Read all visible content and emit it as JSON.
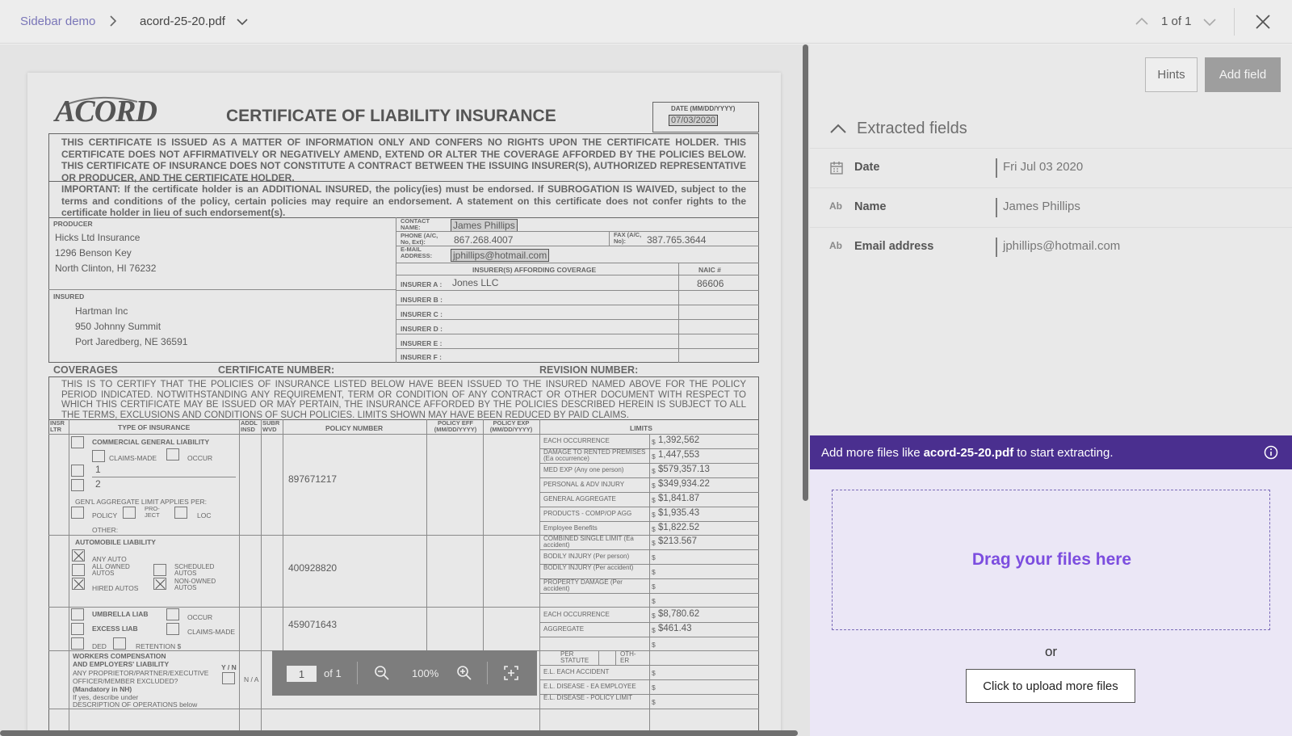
{
  "breadcrumb": {
    "root": "Sidebar demo",
    "file": "acord-25-20.pdf"
  },
  "pager": {
    "text": "1 of 1"
  },
  "document": {
    "title": "CERTIFICATE OF LIABILITY INSURANCE",
    "logo": "ACORD",
    "date_label": "DATE (MM/DD/YYYY)",
    "date_value": "07/03/2020",
    "disclaimer": "THIS CERTIFICATE IS ISSUED AS A MATTER OF INFORMATION ONLY AND CONFERS NO RIGHTS UPON THE CERTIFICATE HOLDER. THIS CERTIFICATE DOES NOT AFFIRMATIVELY OR NEGATIVELY AMEND, EXTEND OR ALTER THE COVERAGE AFFORDED BY THE POLICIES BELOW. THIS CERTIFICATE OF INSURANCE DOES NOT CONSTITUTE A CONTRACT BETWEEN THE ISSUING INSURER(S), AUTHORIZED REPRESENTATIVE OR PRODUCER, AND THE CERTIFICATE HOLDER.",
    "important": "IMPORTANT: If the certificate holder is an ADDITIONAL INSURED, the policy(ies) must be endorsed. If SUBROGATION IS WAIVED, subject to the terms and conditions of the policy, certain policies may require an endorsement. A statement on this certificate does not confer rights to the certificate holder in lieu of such endorsement(s).",
    "producer_label": "PRODUCER",
    "producer_lines": [
      "Hicks Ltd Insurance",
      "1296 Benson Key",
      "North Clinton, HI 76232"
    ],
    "contact_label": "CONTACT NAME:",
    "contact_name": "James Phillips",
    "phone_label": "PHONE (A/C, No, Ext):",
    "phone": "867.268.4007",
    "fax_label": "FAX (A/C, No):",
    "fax": "387.765.3644",
    "email_label": "E-MAIL ADDRESS:",
    "email": "jphillips@hotmail.com",
    "insurers_header": "INSURER(S) AFFORDING COVERAGE",
    "naic_header": "NAIC #",
    "insurer_a_label": "INSURER A :",
    "insurer_a": "Jones LLC",
    "insurer_a_naic": "86606",
    "insurer_labels": [
      "INSURER B :",
      "INSURER C :",
      "INSURER D :",
      "INSURER E :",
      "INSURER F :"
    ],
    "insured_label": "INSURED",
    "insured_lines": [
      "Hartman Inc",
      "950 Johnny Summit",
      "Port Jaredberg, NE 36591"
    ],
    "coverages": "COVERAGES",
    "cert_number": "CERTIFICATE NUMBER:",
    "revision_number": "REVISION NUMBER:",
    "coverage_text": "THIS IS TO CERTIFY THAT THE POLICIES OF INSURANCE LISTED BELOW HAVE BEEN ISSUED TO THE INSURED NAMED ABOVE FOR THE POLICY PERIOD INDICATED. NOTWITHSTANDING ANY REQUIREMENT, TERM OR CONDITION OF ANY CONTRACT OR OTHER DOCUMENT WITH RESPECT TO WHICH THIS CERTIFICATE MAY BE ISSUED OR MAY PERTAIN, THE INSURANCE AFFORDED BY THE POLICIES DESCRIBED HEREIN IS SUBJECT TO ALL THE TERMS, EXCLUSIONS AND CONDITIONS OF SUCH POLICIES. LIMITS SHOWN MAY HAVE BEEN REDUCED BY PAID CLAIMS.",
    "col_headers": {
      "insr": "INSR LTR",
      "type": "TYPE OF INSURANCE",
      "addl": "ADDL INSD",
      "subr": "SUBR WVD",
      "policy": "POLICY NUMBER",
      "eff": "POLICY EFF (MM/DD/YYYY)",
      "exp": "POLICY EXP (MM/DD/YYYY)",
      "limits": "LIMITS"
    },
    "gl": {
      "label": "COMMERCIAL GENERAL LIABILITY",
      "claims_made": "CLAIMS-MADE",
      "occur": "OCCUR",
      "line1": "1",
      "line2": "2",
      "aggregate": "GEN'L AGGREGATE LIMIT APPLIES PER:",
      "policy": "POLICY",
      "project": "PRO- JECT",
      "loc": "LOC",
      "other": "OTHER:",
      "policy_number": "897671217"
    },
    "gl_limits": [
      {
        "label": "EACH OCCURRENCE",
        "value": "1,392,562"
      },
      {
        "label": "DAMAGE TO RENTED PREMISES (Ea occurrence)",
        "value": "1,447,553"
      },
      {
        "label": "MED EXP (Any one person)",
        "value": "$579,357.13"
      },
      {
        "label": "PERSONAL & ADV INJURY",
        "value": "$349,934.22"
      },
      {
        "label": "GENERAL AGGREGATE",
        "value": "$1,841.87"
      },
      {
        "label": "PRODUCTS - COMP/OP AGG",
        "value": "$1,935.43"
      },
      {
        "label": "Employee Benefits",
        "value": "$1,822.52"
      }
    ],
    "auto": {
      "label": "AUTOMOBILE LIABILITY",
      "any_auto": "ANY AUTO",
      "all_owned": "ALL OWNED AUTOS",
      "scheduled": "SCHEDULED AUTOS",
      "hired": "HIRED AUTOS",
      "non_owned": "NON-OWNED AUTOS",
      "policy_number": "400928820"
    },
    "auto_limits": [
      {
        "label": "COMBINED SINGLE LIMIT (Ea accident)",
        "value": "$213.567"
      },
      {
        "label": "BODILY INJURY (Per person)",
        "value": ""
      },
      {
        "label": "BODILY INJURY (Per accident)",
        "value": ""
      },
      {
        "label": "PROPERTY DAMAGE (Per accident)",
        "value": ""
      },
      {
        "label": "",
        "value": ""
      }
    ],
    "umbrella": {
      "umbrella_liab": "UMBRELLA LIAB",
      "excess_liab": "EXCESS LIAB",
      "occur": "OCCUR",
      "claims_made": "CLAIMS-MADE",
      "ded": "DED",
      "retention": "RETENTION $",
      "policy_number": "459071643"
    },
    "umbrella_limits": [
      {
        "label": "EACH OCCURRENCE",
        "value": "$8,780.62"
      },
      {
        "label": "AGGREGATE",
        "value": "$461.43"
      },
      {
        "label": "",
        "value": ""
      }
    ],
    "workers": {
      "label1": "WORKERS COMPENSATION",
      "label2": "AND EMPLOYERS' LIABILITY",
      "yn": "Y / N",
      "proprietor": "ANY PROPRIETOR/PARTNER/EXECUTIVE",
      "officer": "OFFICER/MEMBER EXCLUDED?",
      "mandatory": "(Mandatory in NH)",
      "describe": "If yes, describe under",
      "description": "DESCRIPTION OF OPERATIONS below",
      "na": "N / A",
      "per_statute": "PER STATUTE",
      "other": "OTH- ER"
    },
    "workers_limits": [
      {
        "label": "E.L. EACH ACCIDENT",
        "value": ""
      },
      {
        "label": "E.L. DISEASE - EA EMPLOYEE",
        "value": ""
      },
      {
        "label": "E.L. DISEASE - POLICY LIMIT",
        "value": ""
      }
    ],
    "dollar": "$"
  },
  "toolbar": {
    "page": "1",
    "of": "of 1",
    "zoom": "100%"
  },
  "panel": {
    "hints": "Hints",
    "add_field": "Add field",
    "extracted_title": "Extracted fields",
    "fields": [
      {
        "icon": "calendar-icon",
        "icon_text": "",
        "name": "Date",
        "value": "Fri Jul 03 2020"
      },
      {
        "icon": "text-type-icon",
        "icon_text": "Ab",
        "name": "Name",
        "value": "James Phillips"
      },
      {
        "icon": "text-type-icon",
        "icon_text": "Ab",
        "name": "Email address",
        "value": "jphillips@hotmail.com"
      }
    ],
    "banner_prefix": "Add more files like",
    "banner_file": "acord-25-20.pdf",
    "banner_suffix": "to start extracting.",
    "drop_text": "Drag your files here",
    "or": "or",
    "upload": "Click to upload more files"
  },
  "colors": {
    "accent": "#4a2f8f",
    "drop_text": "#7c4ddf",
    "drop_bg": "#ebe7f6"
  }
}
